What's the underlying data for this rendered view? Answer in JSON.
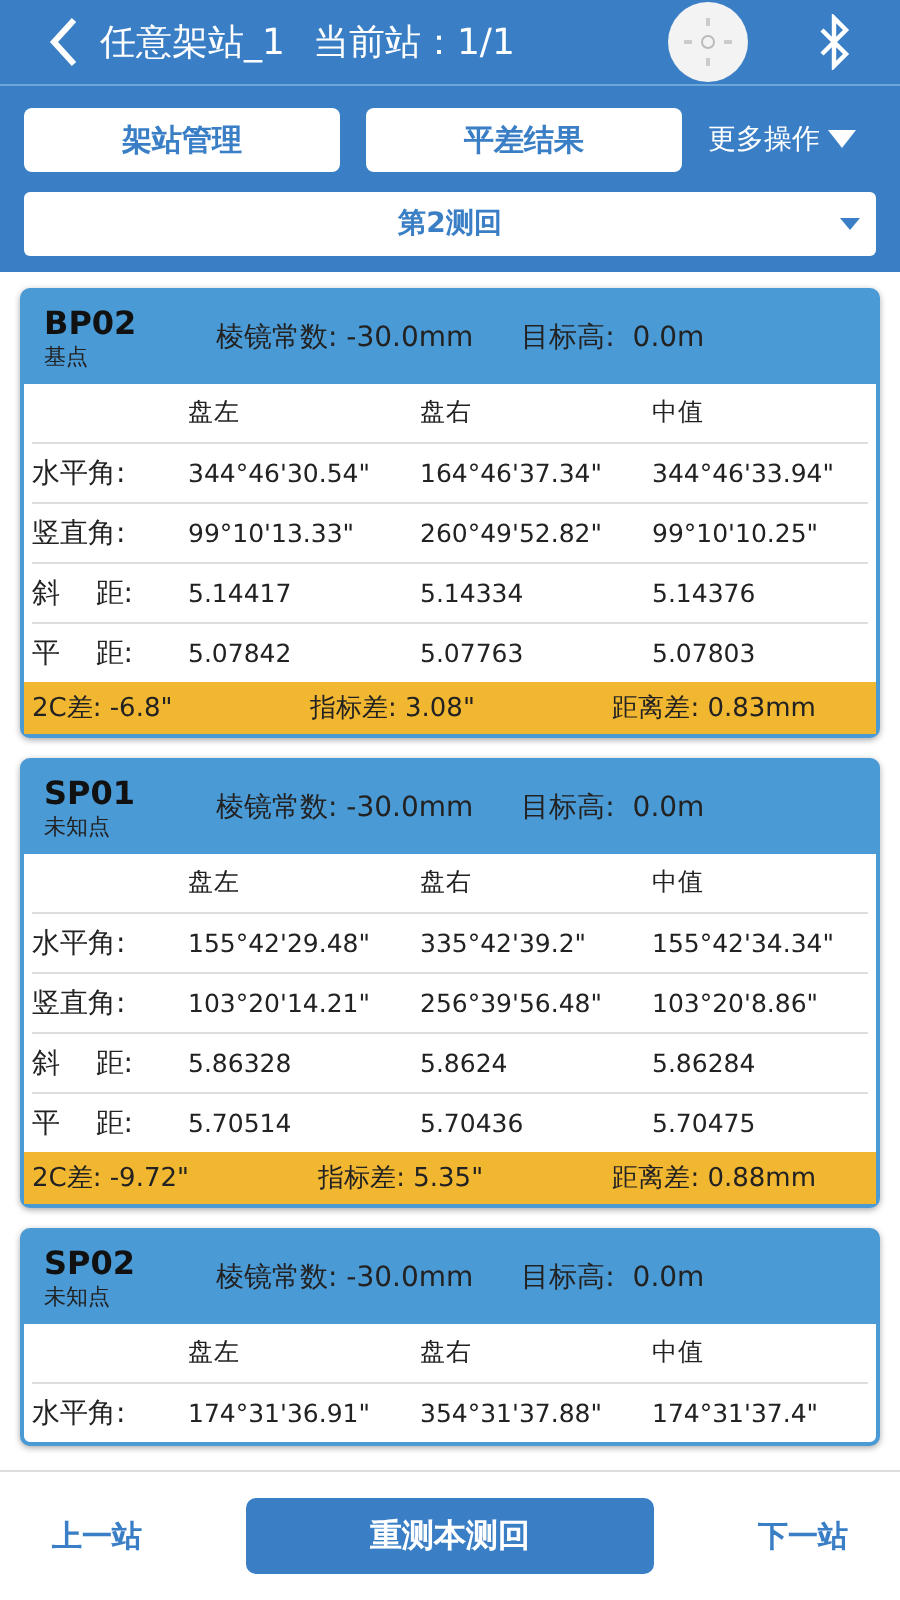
{
  "header": {
    "title": "任意架站_1",
    "station": "当前站：1/1"
  },
  "toolbar": {
    "buttons": [
      "架站管理",
      "平差结果"
    ],
    "more": "更多操作"
  },
  "round_select": {
    "value": "第2测回"
  },
  "points": [
    {
      "name": "BP02",
      "type": "基点",
      "prism": "棱镜常数: -30.0mm",
      "target": "目标高:  0.0m",
      "columns": [
        "盘左",
        "盘右",
        "中值"
      ],
      "rows": [
        {
          "label": "水平角:",
          "values": [
            "344°46'30.54\"",
            "164°46'37.34\"",
            "344°46'33.94\""
          ]
        },
        {
          "label": "竖直角:",
          "values": [
            "99°10'13.33\"",
            "260°49'52.82\"",
            "99°10'10.25\""
          ]
        },
        {
          "label": "斜    距:",
          "values": [
            "5.14417",
            "5.14334",
            "5.14376"
          ]
        },
        {
          "label": "平    距:",
          "values": [
            "5.07842",
            "5.07763",
            "5.07803"
          ]
        }
      ],
      "summary": [
        "2C差: -6.8\"",
        "指标差: 3.08\"",
        "距离差: 0.83mm"
      ]
    },
    {
      "name": "SP01",
      "type": "未知点",
      "prism": "棱镜常数: -30.0mm",
      "target": "目标高:  0.0m",
      "columns": [
        "盘左",
        "盘右",
        "中值"
      ],
      "rows": [
        {
          "label": "水平角:",
          "values": [
            "155°42'29.48\"",
            "335°42'39.2\"",
            "155°42'34.34\""
          ]
        },
        {
          "label": "竖直角:",
          "values": [
            "103°20'14.21\"",
            "256°39'56.48\"",
            "103°20'8.86\""
          ]
        },
        {
          "label": "斜    距:",
          "values": [
            "5.86328",
            "5.8624",
            "5.86284"
          ]
        },
        {
          "label": "平    距:",
          "values": [
            "5.70514",
            "5.70436",
            "5.70475"
          ]
        }
      ],
      "summary": [
        "2C差: -9.72\"",
        "指标差: 5.35\"",
        "距离差: 0.88mm"
      ]
    },
    {
      "name": "SP02",
      "type": "未知点",
      "prism": "棱镜常数: -30.0mm",
      "target": "目标高:  0.0m",
      "columns": [
        "盘左",
        "盘右",
        "中值"
      ],
      "rows": [
        {
          "label": "水平角:",
          "values": [
            "174°31'36.91\"",
            "354°31'37.88\"",
            "174°31'37.4\""
          ]
        }
      ]
    }
  ],
  "footer": {
    "prev": "上一站",
    "action": "重测本测回",
    "next": "下一站"
  }
}
